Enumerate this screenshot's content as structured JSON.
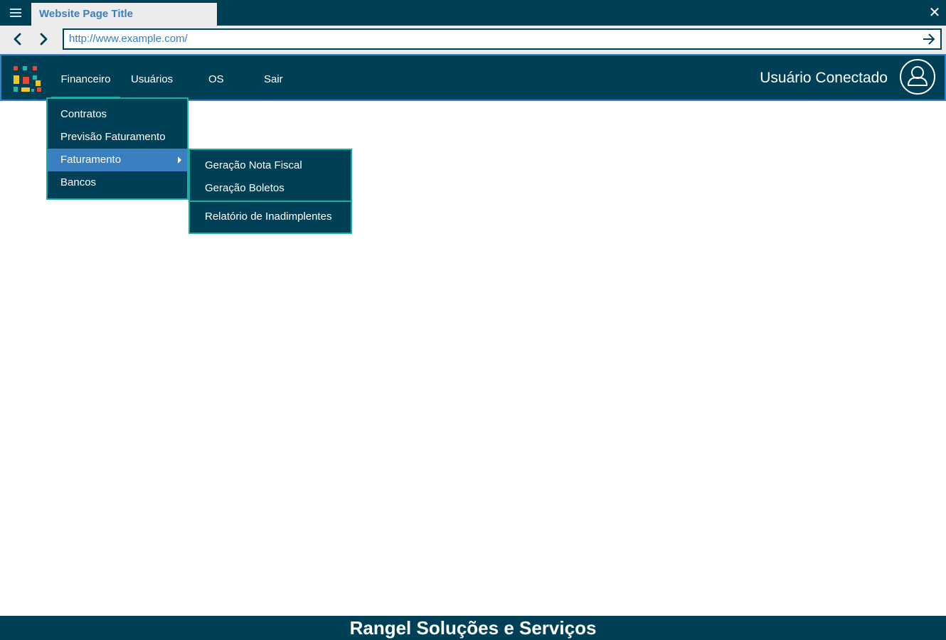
{
  "browser": {
    "tab_title": "Website Page Title",
    "url": "http://www.example.com/",
    "close_glyph": "✕",
    "icons": [
      "menu-icon",
      "back-icon",
      "forward-icon",
      "go-icon",
      "close-icon"
    ]
  },
  "header": {
    "nav": [
      {
        "label": "Financeiro",
        "active": true
      },
      {
        "label": "Usuários"
      },
      {
        "label": "OS"
      },
      {
        "label": "Sair"
      }
    ],
    "user_label": "Usuário Conectado",
    "logo_icon": "app-logo-icon",
    "avatar_icon": "user-avatar-icon"
  },
  "financeiro_menu": {
    "items": [
      {
        "label": "Contratos"
      },
      {
        "label": "Previsão Faturamento"
      },
      {
        "label": "Faturamento",
        "has_submenu": true,
        "active": true
      },
      {
        "label": "Bancos"
      }
    ]
  },
  "faturamento_submenu": {
    "items": [
      {
        "label": "Geração Nota Fiscal"
      },
      {
        "label": "Geração Boletos"
      },
      {
        "label": "Relatório de Inadimplentes"
      }
    ]
  },
  "footer": {
    "text": "Rangel Soluções e Serviços"
  },
  "colors": {
    "primary": "#004057",
    "accent": "#1faaa3",
    "highlight": "#3a7fc0",
    "chrome": "#ececec"
  }
}
